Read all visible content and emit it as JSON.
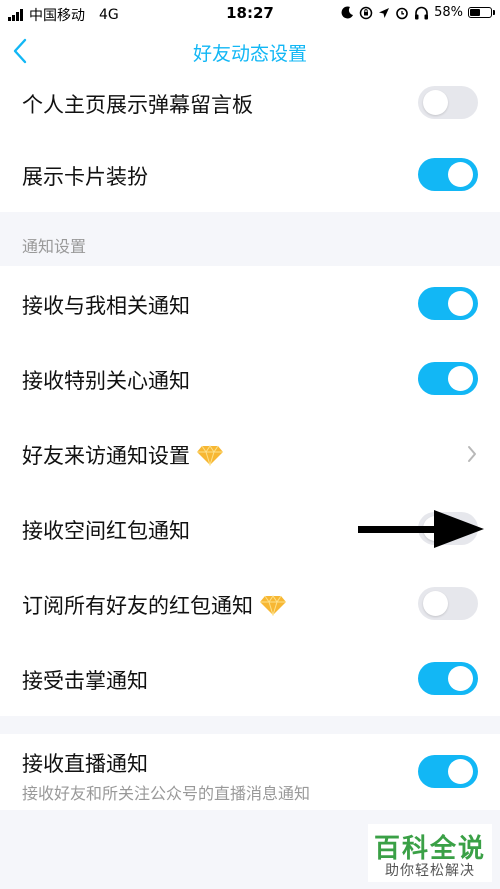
{
  "status_bar": {
    "carrier": "中国移动",
    "network": "4G",
    "time": "18:27",
    "battery": "58%",
    "battery_level": 0.58
  },
  "nav": {
    "title": "好友动态设置",
    "back_icon": "chevron-left-icon"
  },
  "colors": {
    "accent": "#12b7f5",
    "switch_off": "#e6e7ec",
    "background": "#f5f6fa",
    "watermark_green": "#3aa046"
  },
  "top_group": {
    "items": [
      {
        "label": "个人主页展示弹幕留言板",
        "switch": false
      },
      {
        "label": "展示卡片装扮",
        "switch": true
      }
    ]
  },
  "notification_section": {
    "header": "通知设置",
    "items": [
      {
        "label": "接收与我相关通知",
        "switch": true
      },
      {
        "label": "接收特别关心通知",
        "switch": true
      },
      {
        "label": "好友来访通知设置",
        "icon": "diamond-icon",
        "control": "chevron-right-icon"
      },
      {
        "label": "接收空间红包通知",
        "switch": false
      },
      {
        "label": "订阅所有好友的红包通知",
        "icon": "diamond-icon",
        "switch": false
      },
      {
        "label": "接受击掌通知",
        "switch": true
      }
    ]
  },
  "live_group": {
    "items": [
      {
        "label": "接收直播通知",
        "subtitle": "接收好友和所关注公众号的直播消息通知",
        "switch": true
      }
    ]
  },
  "watermark": {
    "title": "百科全说",
    "subtitle": "助你轻松解决"
  }
}
